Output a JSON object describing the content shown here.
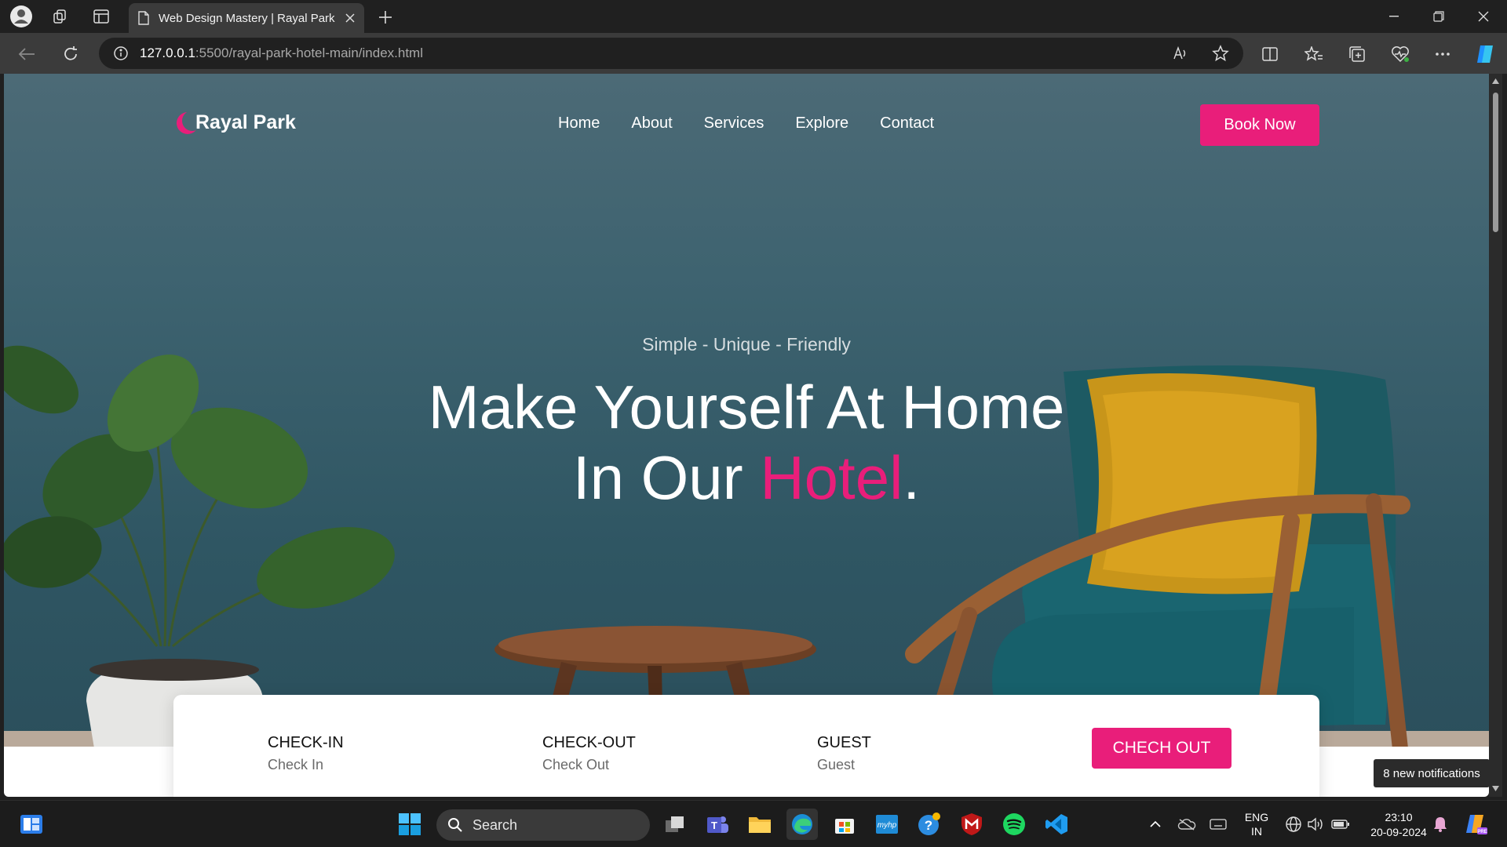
{
  "browser": {
    "tab_title": "Web Design Mastery | Rayal Park",
    "url_host": "127.0.0.1",
    "url_path": ":5500/rayal-park-hotel-main/index.html"
  },
  "site": {
    "logo_text": "Rayal Park",
    "nav": [
      "Home",
      "About",
      "Services",
      "Explore",
      "Contact"
    ],
    "book_button": "Book Now",
    "hero_subtitle": "Simple - Unique - Friendly",
    "hero_line1": "Make Yourself At Home",
    "hero_line2_pre": "In Our ",
    "hero_line2_accent": "Hotel",
    "hero_line2_post": ".",
    "accent_color": "#e91e7a"
  },
  "booking": {
    "checkin_label": "CHECK-IN",
    "checkin_value": "Check In",
    "checkout_label": "CHECK-OUT",
    "checkout_value": "Check Out",
    "guest_label": "GUEST",
    "guest_value": "Guest",
    "submit_button": "CHECH OUT"
  },
  "notification_toast": "8 new notifications",
  "taskbar": {
    "search_label": "Search",
    "lang_line1": "ENG",
    "lang_line2": "IN",
    "time": "23:10",
    "date": "20-09-2024"
  }
}
